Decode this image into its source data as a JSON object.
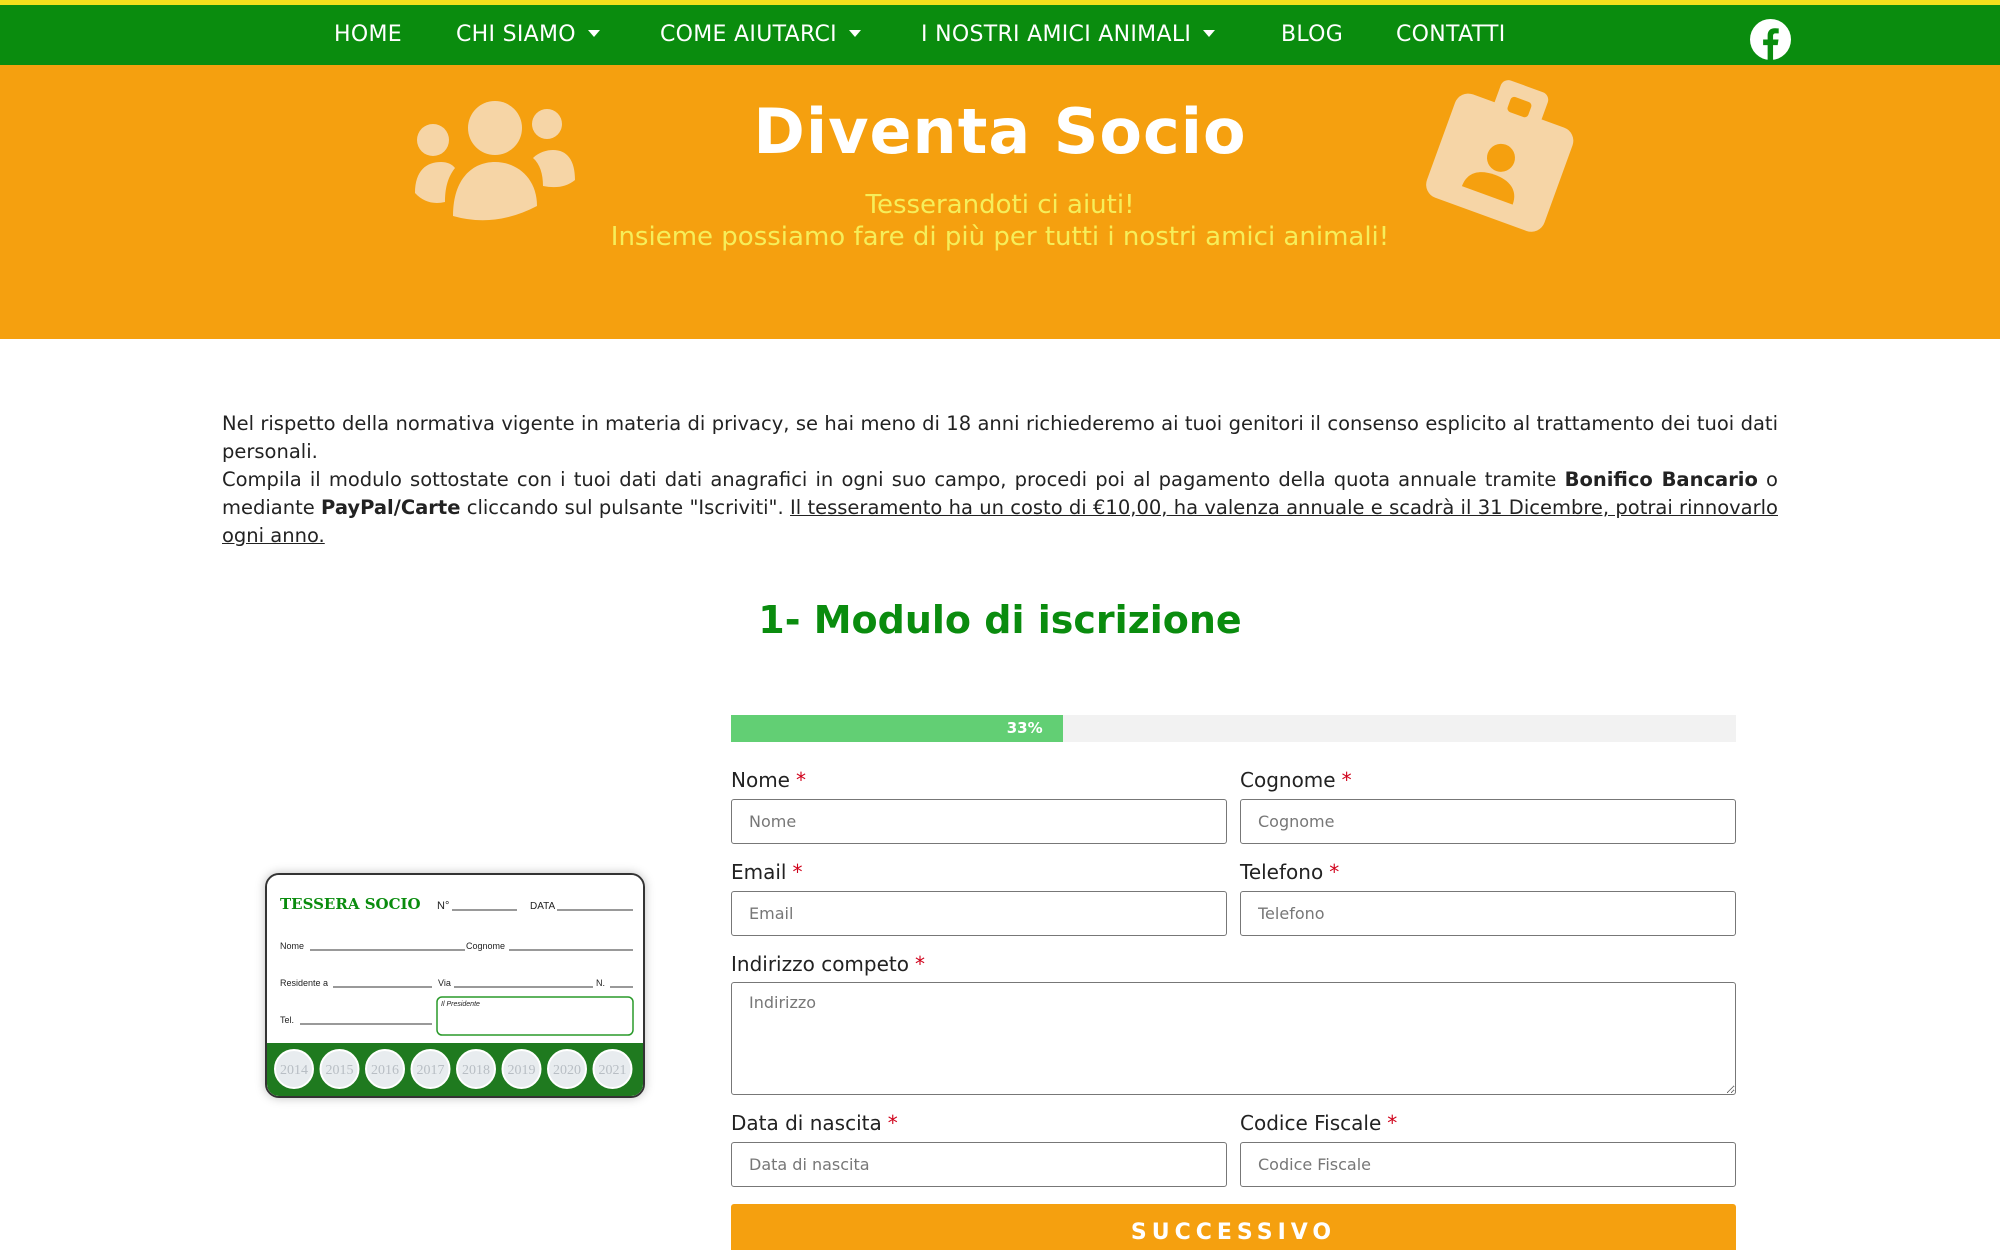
{
  "nav": {
    "items": [
      {
        "label": "HOME",
        "dropdown": false
      },
      {
        "label": "CHI SIAMO",
        "dropdown": true
      },
      {
        "label": "COME AIUTARCI",
        "dropdown": true
      },
      {
        "label": "I NOSTRI AMICI ANIMALI",
        "dropdown": true
      },
      {
        "label": "BLOG",
        "dropdown": false
      },
      {
        "label": "CONTATTI",
        "dropdown": false
      }
    ],
    "social_icon": "facebook-icon"
  },
  "hero": {
    "title": "Diventa Socio",
    "subtitle_line1": "Tesserandoti ci aiuti!",
    "subtitle_line2": "Insieme possiamo fare di più per tutti i nostri amici animali!",
    "icon_left": "people-group-icon",
    "icon_right": "id-badge-icon"
  },
  "intro": {
    "p1": "Nel rispetto della normativa vigente in materia di privacy, se hai meno di 18 anni richiederemo ai tuoi genitori il consenso esplicito al trattamento dei tuoi dati personali.",
    "p2_a": "Compila il modulo sottostate con i tuoi dati dati anagrafici in ogni suo campo, procedi poi al pagamento della quota annuale tramite ",
    "p2_b": "Bonifico Bancario",
    "p2_c": " o mediante ",
    "p2_d": "PayPal/Carte",
    "p2_e": " cliccando sul pulsante \"Iscriviti\". ",
    "p2_f": "Il tesseramento ha un costo di €10,00, ha valenza annuale e scadrà il 31 Dicembre, potrai rinnovarlo ogni anno."
  },
  "section_title": "1- Modulo di iscrizione",
  "card": {
    "title": "TESSERA SOCIO",
    "no_label": "N°",
    "data_label": "DATA",
    "nome_label": "Nome",
    "cognome_label": "Cognome",
    "residente_label": "Residente a",
    "via_label": "Via",
    "n_label": "N.",
    "tel_label": "Tel.",
    "presidente_label": "Il Presidente",
    "years": [
      "2014",
      "2015",
      "2016",
      "2017",
      "2018",
      "2019",
      "2020",
      "2021"
    ]
  },
  "form": {
    "progress_percent": 33,
    "progress_label": "33%",
    "nome_label": "Nome",
    "nome_placeholder": "Nome",
    "cognome_label": "Cognome",
    "cognome_placeholder": "Cognome",
    "email_label": "Email",
    "email_placeholder": "Email",
    "telefono_label": "Telefono",
    "telefono_placeholder": "Telefono",
    "indirizzo_label": "Indirizzo competo",
    "indirizzo_placeholder": "Indirizzo",
    "nascita_label": "Data di nascita",
    "nascita_placeholder": "Data di nascita",
    "cf_label": "Codice Fiscale",
    "cf_placeholder": "Codice Fiscale",
    "required_mark": "*",
    "next_button": "SUCCESSIVO"
  },
  "colors": {
    "nav_green": "#0a8c0e",
    "hero_orange": "#f5a00f",
    "subtitle_yellow": "#f6ee5a",
    "progress_green": "#62cf74",
    "required_red": "#d0021b"
  }
}
